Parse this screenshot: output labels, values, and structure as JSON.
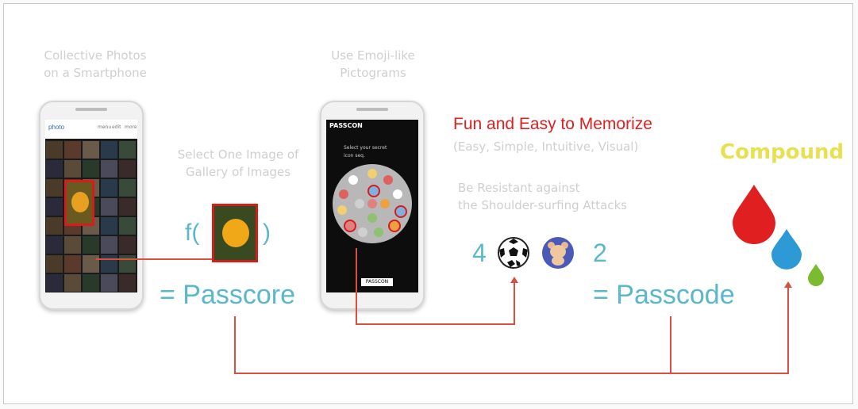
{
  "phone1": {
    "caption": "Collective Photos",
    "caption2": "on a Smartphone",
    "app_name": "photo",
    "menu": [
      "menu",
      "edit",
      "more"
    ]
  },
  "select_caption": {
    "line1": "Select One Image of",
    "line2": "Gallery of Images"
  },
  "formula": {
    "open": "f(",
    "close": ")",
    "result": "= Passcore"
  },
  "phone2": {
    "caption": "Use Emoji-like",
    "caption2": "Pictograms",
    "app_title": "PASSCON",
    "prompt1": "Select your secret",
    "prompt2": "icon seq.",
    "footer_logo": "PASSCON"
  },
  "fun_title": "Fun and Easy to Memorize",
  "fun_sub": "(Easy, Simple, Intuitive, Visual)",
  "anti_line1": "Be Resistant against",
  "anti_line2": "the Shoulder-surfing Attacks",
  "passcode_seq": {
    "first": "4",
    "last": "2",
    "result": "= Passcode"
  },
  "compound_label": "Compound",
  "colors": {
    "red": "#e02020",
    "teal": "#5ab8c8",
    "yellow": "#e8e050",
    "blue": "#2d9ad6",
    "green": "#7bbb30",
    "line": "#d85040"
  },
  "icons": [
    "soccer-ball-icon",
    "teddy-bear-icon",
    "red-drop-icon",
    "blue-drop-icon",
    "green-drop-icon"
  ]
}
